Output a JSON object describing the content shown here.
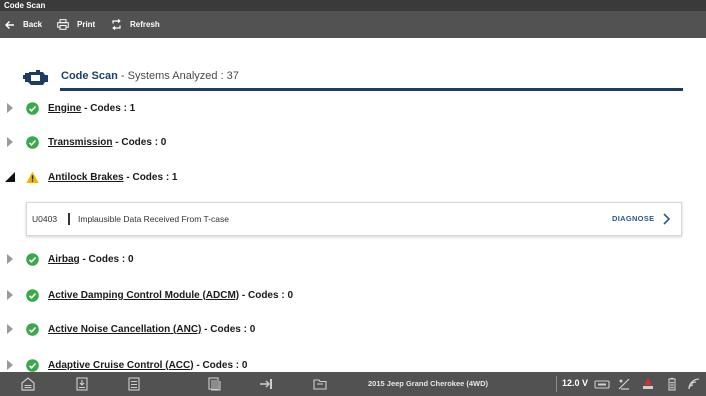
{
  "window": {
    "title": "Code Scan"
  },
  "toolbar": {
    "back": "Back",
    "print": "Print",
    "refresh": "Refresh"
  },
  "header": {
    "title": "Code Scan",
    "subtitle": " - Systems Analyzed : 37"
  },
  "systems": [
    {
      "name": "Engine",
      "codes": " - Codes : 1",
      "status": "ok",
      "expanded": false
    },
    {
      "name": "Transmission",
      "codes": " - Codes : 0",
      "status": "ok",
      "expanded": false
    },
    {
      "name": "Antilock Brakes",
      "codes": " - Codes : 1",
      "status": "warning",
      "expanded": true
    },
    {
      "name": "Airbag",
      "codes": " - Codes : 0",
      "status": "ok",
      "expanded": false
    },
    {
      "name": "Active Damping Control Module (ADCM)",
      "codes": " - Codes : 0",
      "status": "ok",
      "expanded": false
    },
    {
      "name": "Active Noise Cancellation (ANC)",
      "codes": " - Codes : 0",
      "status": "ok",
      "expanded": false
    },
    {
      "name": "Adaptive Cruise Control (ACC)",
      "codes": " - Codes : 0",
      "status": "ok",
      "expanded": false
    }
  ],
  "code_detail": {
    "code": "U0403",
    "description": "Implausible Data Received From T-case",
    "action": "DIAGNOSE"
  },
  "bottombar": {
    "vehicle": "2015 Jeep Grand Cherokee (4WD)",
    "voltage": "12.0 V"
  },
  "colors": {
    "ok": "#3aa94a",
    "warning": "#f2b705",
    "accent": "#1c3c66",
    "bar": "#525252"
  }
}
